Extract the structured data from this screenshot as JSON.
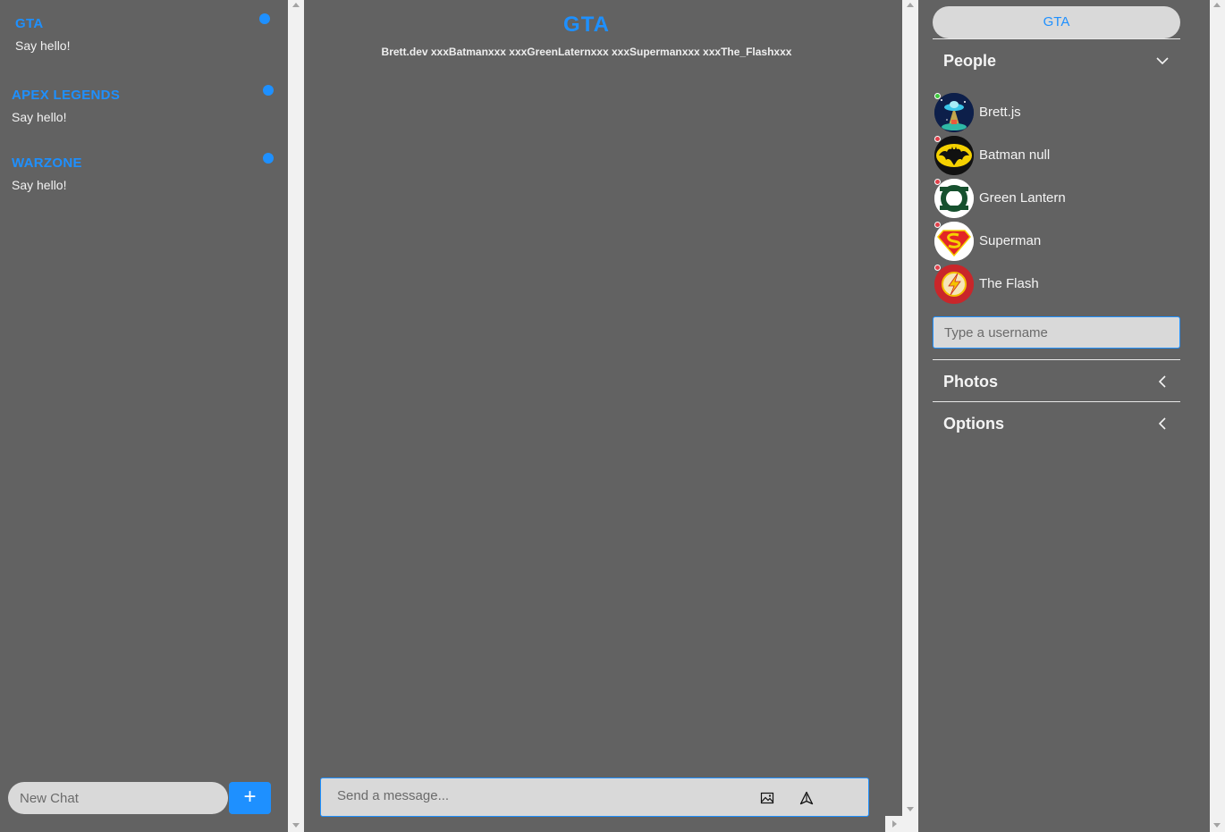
{
  "chats": [
    {
      "title": "GTA",
      "subtitle": "Say hello!"
    },
    {
      "title": "APEX LEGENDS",
      "subtitle": "Say hello!"
    },
    {
      "title": "WARZONE",
      "subtitle": "Say hello!"
    }
  ],
  "new_chat": {
    "placeholder": "New Chat",
    "add_label": "+"
  },
  "feed": {
    "title": "GTA",
    "members": "Brett.dev xxxBatmanxxx xxxGreenLaternxxx xxxSupermanxxx xxxThe_Flashxxx"
  },
  "message_form": {
    "placeholder": "Send a message...",
    "image_icon": "image-icon",
    "send_icon": "send-icon"
  },
  "settings": {
    "chat_name": "GTA",
    "people_title": "People",
    "people": [
      {
        "name": "Brett.js",
        "status": "online",
        "status_color": "#3ec93e",
        "avatar": "ufo-avatar"
      },
      {
        "name": "Batman null",
        "status": "offline",
        "status_color": "#e0414b",
        "avatar": "batman-avatar"
      },
      {
        "name": "Green Lantern",
        "status": "offline",
        "status_color": "#e0414b",
        "avatar": "green-lantern-avatar"
      },
      {
        "name": "Superman",
        "status": "offline",
        "status_color": "#e0414b",
        "avatar": "superman-avatar"
      },
      {
        "name": "The Flash",
        "status": "offline",
        "status_color": "#e0414b",
        "avatar": "flash-avatar"
      }
    ],
    "username_placeholder": "Type a username",
    "photos_title": "Photos",
    "options_title": "Options"
  },
  "colors": {
    "accent": "#1e90ff",
    "background": "#626262",
    "input_bg": "#d9d9d9"
  }
}
